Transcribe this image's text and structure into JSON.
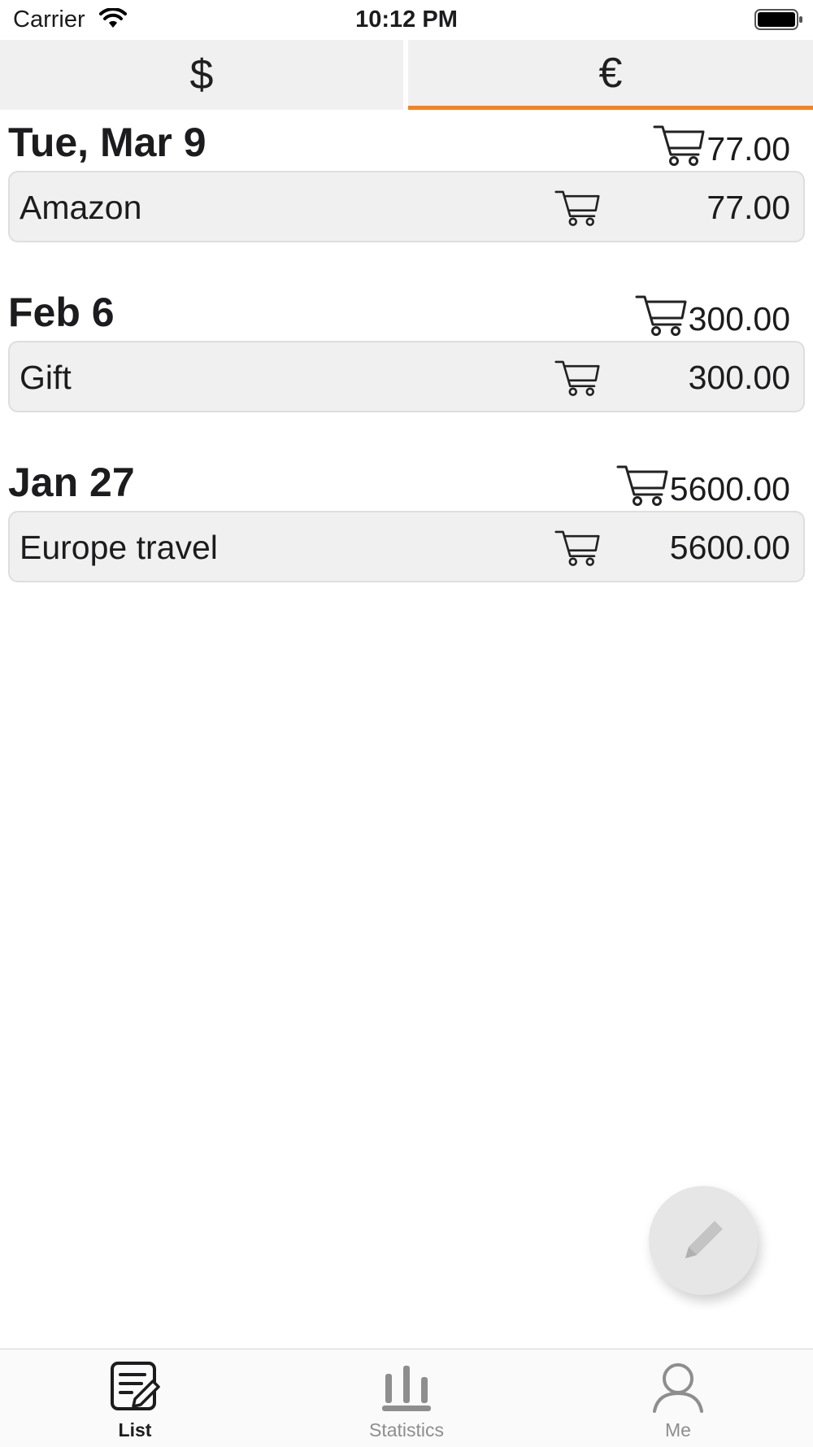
{
  "status_bar": {
    "carrier": "Carrier",
    "time": "10:12 PM"
  },
  "currency_tabs": [
    {
      "symbol": "$",
      "selected": false
    },
    {
      "symbol": "€",
      "selected": true
    }
  ],
  "accent_color": "#f58220",
  "groups": [
    {
      "date": "Tue, Mar 9",
      "total": "77.00",
      "items": [
        {
          "name": "Amazon",
          "icon": "cart-icon",
          "amount": "77.00"
        }
      ]
    },
    {
      "date": "Feb 6",
      "total": "300.00",
      "items": [
        {
          "name": "Gift",
          "icon": "cart-icon",
          "amount": "300.00"
        }
      ]
    },
    {
      "date": "Jan 27",
      "total": "5600.00",
      "items": [
        {
          "name": "Europe travel",
          "icon": "cart-icon",
          "amount": "5600.00"
        }
      ]
    }
  ],
  "fab": {
    "icon": "pencil-icon"
  },
  "tab_bar": {
    "items": [
      {
        "label": "List",
        "icon": "list-edit-icon",
        "active": true
      },
      {
        "label": "Statistics",
        "icon": "bar-chart-icon",
        "active": false
      },
      {
        "label": "Me",
        "icon": "person-icon",
        "active": false
      }
    ]
  }
}
